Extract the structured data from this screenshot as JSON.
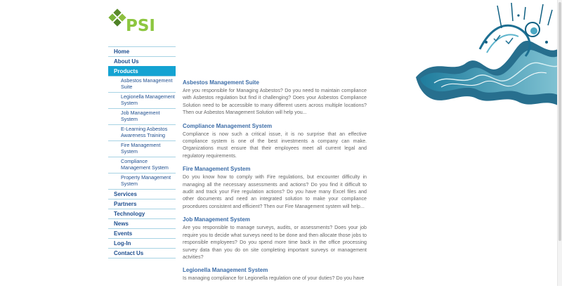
{
  "logo": {
    "text": "PSI"
  },
  "nav": {
    "items": [
      {
        "label": "Home"
      },
      {
        "label": "About Us"
      },
      {
        "label": "Products"
      }
    ],
    "sub_items": [
      {
        "label": "Asbestos Management Suite"
      },
      {
        "label": "Legionella Management System"
      },
      {
        "label": "Job Management System"
      },
      {
        "label": "E-Learning Asbestos Awareness Training"
      },
      {
        "label": "Fire Management System"
      },
      {
        "label": "Compliance Management System"
      },
      {
        "label": "Property Management System"
      }
    ],
    "items_after": [
      {
        "label": "Services"
      },
      {
        "label": "Partners"
      },
      {
        "label": "Technology"
      },
      {
        "label": "News"
      },
      {
        "label": "Events"
      },
      {
        "label": "Log-In"
      },
      {
        "label": "Contact Us"
      }
    ],
    "active": "Products"
  },
  "articles": [
    {
      "title": "Asbestos Management Suite",
      "body": "Are you responsible for Managing Asbestos? Do you need to maintain compliance with Asbestos regulation but find it challenging? Does your Asbestos Compliance Solution need to be accessible to many different users across multiple locations? Then our Asbestos Management Solution will help you..."
    },
    {
      "title": "Compliance Management System",
      "body": "Compliance is now such a critical issue, it is no surprise that an effective compliance system is one of the best investments a company can make. Organizations must ensure that their employees meet all current legal and regulatory requirements."
    },
    {
      "title": "Fire Management System",
      "body": "Do you know how to comply with Fire regulations, but encounter difficulty in managing all the necessary assessments and actions? Do you find it difficult to audit and track your Fire regulation actions? Do you have many Excel files and other documents and need an integrated solution to make your compliance procedures consistent and efficient? Then our Fire Management system will help..."
    },
    {
      "title": "Job Management System",
      "body": "Are you responsible to manage surveys, audits, or assessments? Does your job require you to decide what surveys need to be done and then allocate those jobs to responsible employees? Do you spend more time back in the office processing survey data than you do on site completing important surveys or management actvities?"
    },
    {
      "title": "Legionella Management System",
      "body": "Is managing compliance for Legionella regulation one of your duties? Do you have"
    }
  ],
  "colors": {
    "accent": "#14a3d2",
    "nav_text": "#1f4f8f",
    "heading": "#3e6ea8",
    "logo_green": "#8cc63f",
    "body_text": "#666666"
  }
}
